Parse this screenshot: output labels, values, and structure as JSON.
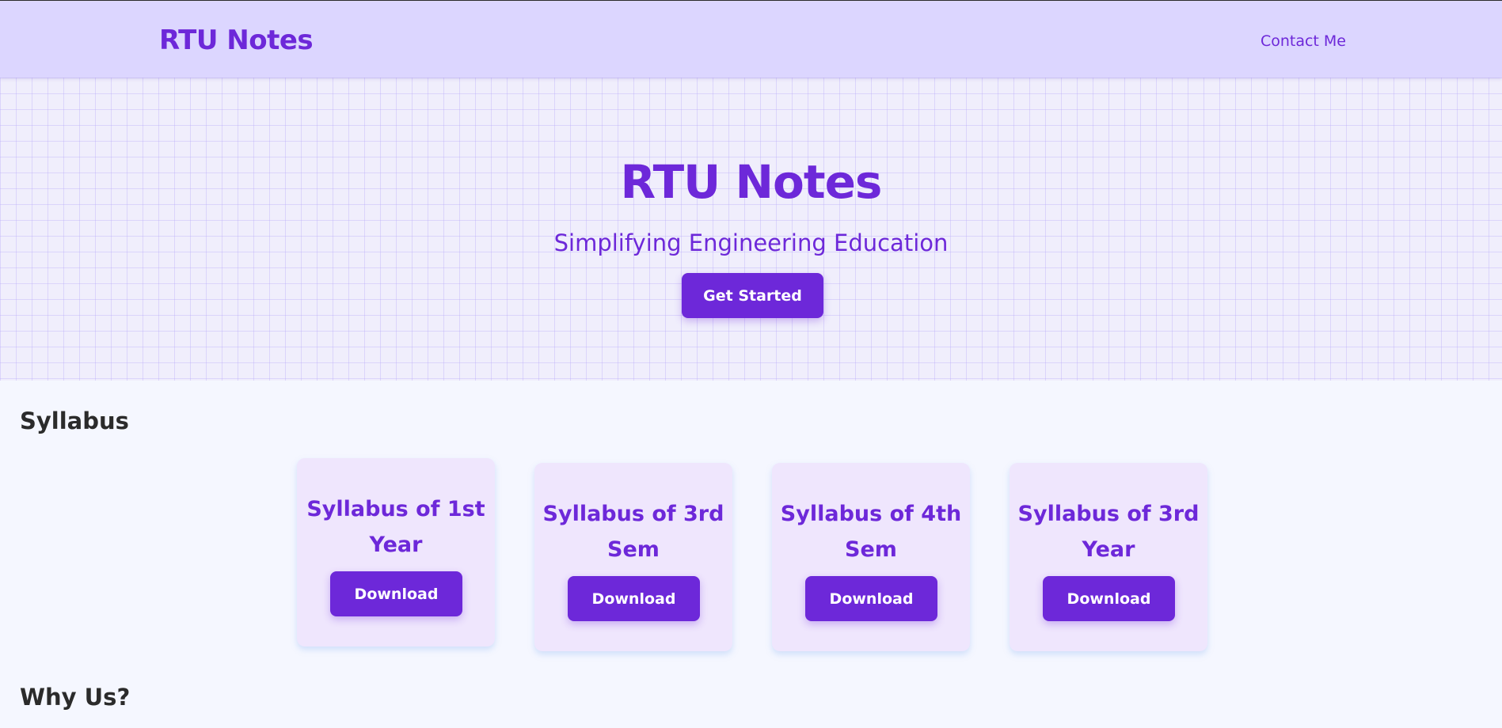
{
  "navbar": {
    "brand": "RTU Notes",
    "contact_link": "Contact Me"
  },
  "hero": {
    "title": "RTU Notes",
    "subtitle": "Simplifying Engineering Education",
    "cta_label": "Get Started"
  },
  "syllabus": {
    "heading": "Syllabus",
    "cards": [
      {
        "title": "Syllabus of 1st Year",
        "button_label": "Download"
      },
      {
        "title": "Syllabus of 3rd Sem",
        "button_label": "Download"
      },
      {
        "title": "Syllabus of 4th Sem",
        "button_label": "Download"
      },
      {
        "title": "Syllabus of 3rd Year",
        "button_label": "Download"
      }
    ]
  },
  "why_us": {
    "heading": "Why Us?"
  },
  "colors": {
    "accent": "#6d28d9",
    "navbar_bg": "#dcd6ff",
    "card_bg": "#efe6fd",
    "page_bg": "#f5f7ff"
  }
}
